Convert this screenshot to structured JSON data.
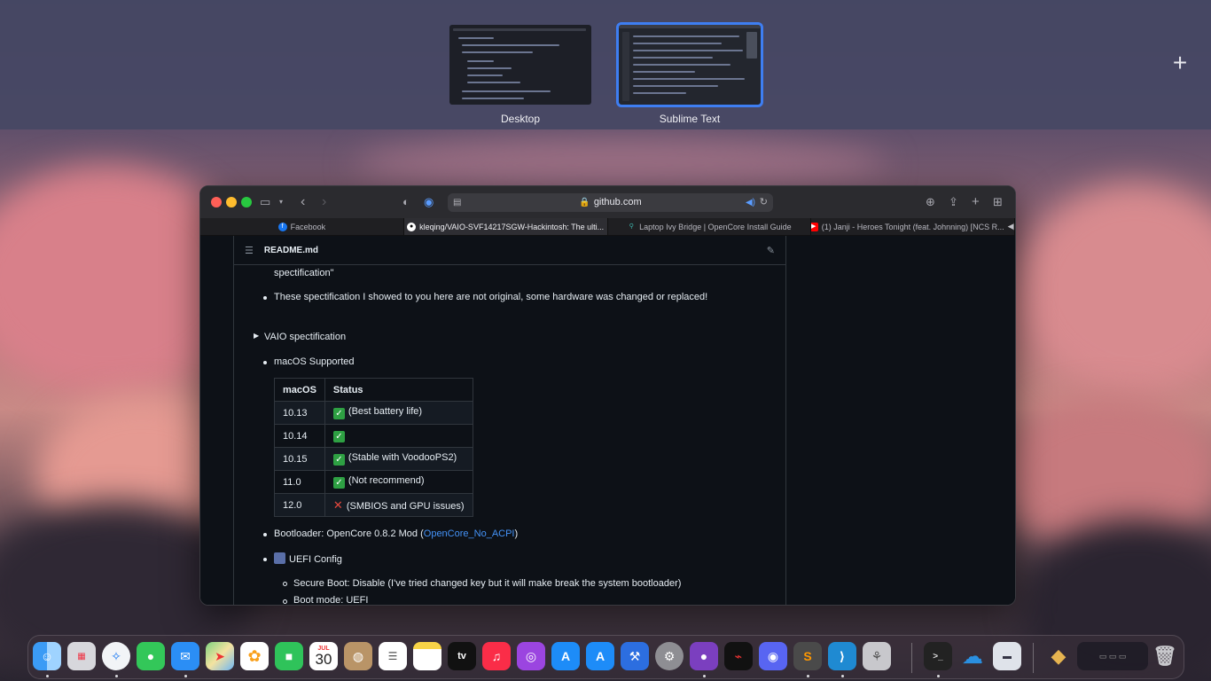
{
  "spaces": [
    {
      "label": "Desktop"
    },
    {
      "label": "Sublime Text"
    }
  ],
  "add_space_icon": "plus-icon",
  "browser": {
    "url": "github.com",
    "tabs": [
      {
        "label": "Facebook",
        "color": "#1877f2"
      },
      {
        "label": "kleqing/VAIO-SVF14217SGW-Hackintosh: The ulti...",
        "color": "#ffffff"
      },
      {
        "label": "Laptop Ivy Bridge | OpenCore Install Guide",
        "color": "#3fb8af"
      },
      {
        "label": "(1) Janji - Heroes Tonight (feat. Johnning) [NCS R...",
        "color": "#ff0000"
      }
    ]
  },
  "readme": {
    "filename": "README.md",
    "line_spec_tail": "spectification\"",
    "line_not_original": "These spectification I showed to you here are not original, some hardware was changed or replaced!",
    "vaio_spec": "VAIO spectification",
    "macos_supported": "macOS Supported",
    "table": {
      "headers": [
        "macOS",
        "Status"
      ],
      "rows": [
        {
          "version": "10.13",
          "status": "(Best battery life)",
          "ok": true
        },
        {
          "version": "10.14",
          "status": "",
          "ok": true
        },
        {
          "version": "10.15",
          "status": "(Stable with VoodooPS2)",
          "ok": true
        },
        {
          "version": "11.0",
          "status": "(Not recommend)",
          "ok": true
        },
        {
          "version": "12.0",
          "status": "(SMBIOS and GPU issues)",
          "ok": false
        }
      ]
    },
    "bootloader_prefix": "Bootloader: OpenCore 0.8.2 Mod (",
    "bootloader_link": "OpenCore_No_ACPI",
    "bootloader_suffix": ")",
    "uefi_config": "UEFI Config",
    "secure_boot": "Secure Boot: Disable (I've tried changed key but it will make break the system bootloader)",
    "boot_mode": "Boot mode: UEFI"
  },
  "dock": {
    "calendar_month": "JUL",
    "calendar_day": "30",
    "tv_label": "tv"
  }
}
